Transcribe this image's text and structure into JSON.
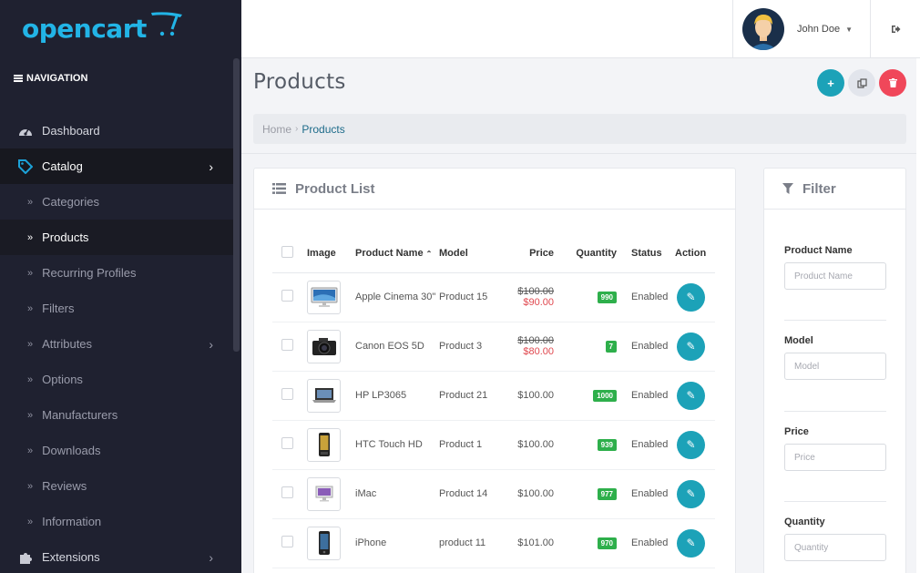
{
  "brand": {
    "logo_text": "opencart"
  },
  "sidebar": {
    "heading": "NAVIGATION",
    "items": [
      {
        "label": "Dashboard",
        "icon": "dashboard-icon"
      },
      {
        "label": "Catalog",
        "icon": "tag-icon"
      },
      {
        "label": "Categories"
      },
      {
        "label": "Products"
      },
      {
        "label": "Recurring Profiles"
      },
      {
        "label": "Filters"
      },
      {
        "label": "Attributes"
      },
      {
        "label": "Options"
      },
      {
        "label": "Manufacturers"
      },
      {
        "label": "Downloads"
      },
      {
        "label": "Reviews"
      },
      {
        "label": "Information"
      },
      {
        "label": "Extensions",
        "icon": "puzzle-icon"
      }
    ]
  },
  "header": {
    "user_name": "John Doe"
  },
  "page": {
    "title": "Products",
    "breadcrumb": {
      "home": "Home",
      "separator": "›",
      "current": "Products"
    }
  },
  "product_list": {
    "title": "Product List",
    "columns": [
      "Image",
      "Product Name",
      "Model",
      "Price",
      "Quantity",
      "Status",
      "Action"
    ],
    "rows": [
      {
        "name": "Apple Cinema 30\"",
        "model": "Product 15",
        "price_old": "$100.00",
        "price_new": "$90.00",
        "quantity": "990",
        "status": "Enabled",
        "image": "monitor"
      },
      {
        "name": "Canon EOS 5D",
        "model": "Product 3",
        "price_old": "$100.00",
        "price_new": "$80.00",
        "quantity": "7",
        "status": "Enabled",
        "image": "camera"
      },
      {
        "name": "HP LP3065",
        "model": "Product 21",
        "price": "$100.00",
        "quantity": "1000",
        "status": "Enabled",
        "image": "laptop"
      },
      {
        "name": "HTC Touch HD",
        "model": "Product 1",
        "price": "$100.00",
        "quantity": "939",
        "status": "Enabled",
        "image": "phone"
      },
      {
        "name": "iMac",
        "model": "Product 14",
        "price": "$100.00",
        "quantity": "977",
        "status": "Enabled",
        "image": "imac"
      },
      {
        "name": "iPhone",
        "model": "product 11",
        "price": "$101.00",
        "quantity": "970",
        "status": "Enabled",
        "image": "iphone"
      }
    ]
  },
  "filter": {
    "title": "Filter",
    "fields": [
      {
        "label": "Product Name",
        "placeholder": "Product Name"
      },
      {
        "label": "Model",
        "placeholder": "Model"
      },
      {
        "label": "Price",
        "placeholder": "Price"
      },
      {
        "label": "Quantity",
        "placeholder": "Quantity"
      }
    ]
  },
  "colors": {
    "accent": "#1ca2b8",
    "danger": "#f0475a",
    "sidebar_bg": "#1f2130",
    "logo": "#22b4e6",
    "qty_badge": "#2eaf4b"
  }
}
